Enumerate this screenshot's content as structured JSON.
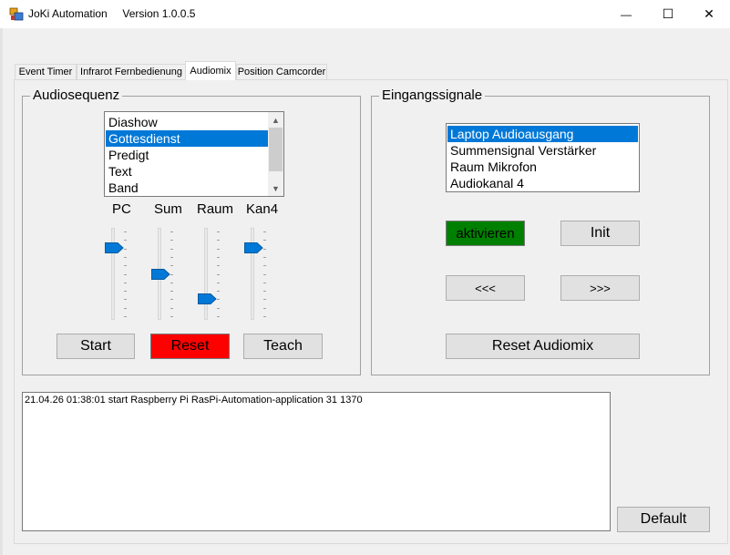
{
  "window": {
    "title": "JoKi Automation",
    "version": "Version 1.0.0.5",
    "minimize_glyph": "—",
    "maximize_glyph": "☐",
    "close_glyph": "✕"
  },
  "tabs": [
    {
      "label": "Event Timer"
    },
    {
      "label": "Infrarot Fernbedienung"
    },
    {
      "label": "Audiomix",
      "active": true
    },
    {
      "label": "Position Camcorder"
    }
  ],
  "audiosequenz": {
    "legend": "Audiosequenz",
    "items": [
      "Diashow",
      "Gottesdienst",
      "Predigt",
      "Text",
      "Band"
    ],
    "selected_index": 1,
    "sliders": [
      {
        "label": "PC",
        "level": 0.78
      },
      {
        "label": "Sum",
        "level": 0.5
      },
      {
        "label": "Raum",
        "level": 0.23
      },
      {
        "label": "Kan4",
        "level": 0.78
      }
    ],
    "start_label": "Start",
    "reset_label": "Reset",
    "teach_label": "Teach"
  },
  "eingangssignale": {
    "legend": "Eingangssignale",
    "items": [
      "Laptop Audioausgang",
      "Summensignal Verstärker",
      "Raum Mikrofon",
      "Audiokanal 4"
    ],
    "selected_index": 0,
    "aktivieren_label": "aktivieren",
    "init_label": "Init",
    "prev_label": "<<<",
    "next_label": ">>>",
    "reset_audiomix_label": "Reset Audiomix"
  },
  "log": {
    "lines": [
      "21.04.26 01:38:01 start Raspberry Pi RasPi-Automation-application 31 1370"
    ]
  },
  "default_label": "Default",
  "colors": {
    "selection": "#0078d7",
    "aktivieren_bg": "#008000",
    "reset_bg": "#ff0000",
    "window_bg": "#f0f0f0"
  }
}
